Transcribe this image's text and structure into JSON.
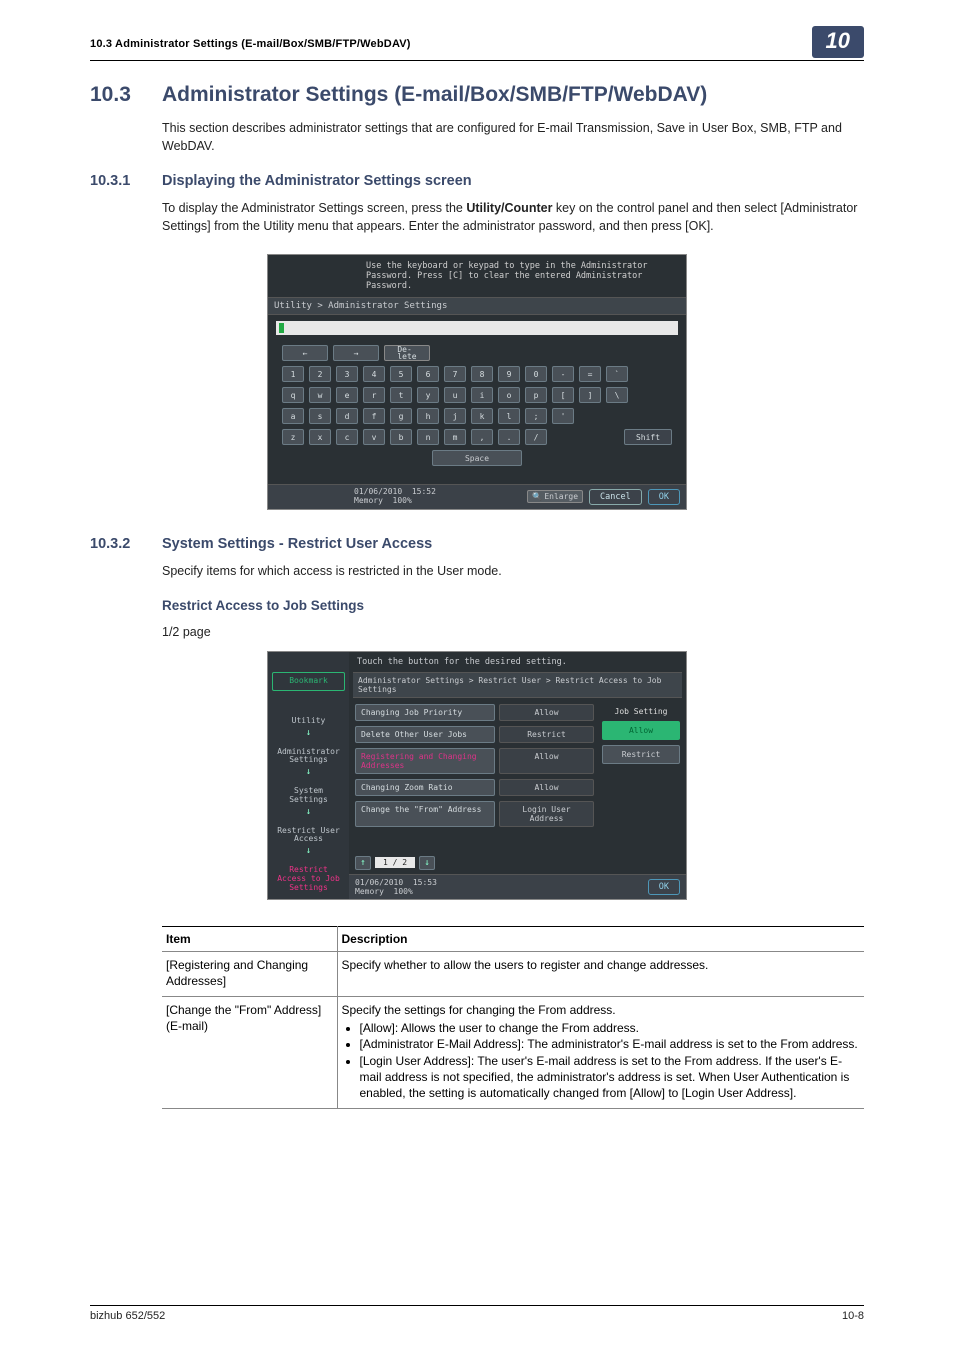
{
  "header": {
    "running_head": "10.3    Administrator Settings (E-mail/Box/SMB/FTP/WebDAV)",
    "chapter_badge": "10"
  },
  "section": {
    "num": "10.3",
    "title": "Administrator Settings (E-mail/Box/SMB/FTP/WebDAV)",
    "intro": "This section describes administrator settings that are configured for E-mail Transmission, Save in User Box, SMB, FTP and WebDAV."
  },
  "sub1": {
    "num": "10.3.1",
    "title": "Displaying the Administrator Settings screen",
    "body_pre": "To display the Administrator Settings screen, press the ",
    "body_bold": "Utility/Counter",
    "body_post": " key on the control panel and then select [Administrator Settings] from the Utility menu that appears. Enter the administrator password, and then press [OK]."
  },
  "keypad": {
    "message": "Use the keyboard or keypad to type in the Administrator Password.  Press [C] to clear the entered Administrator Password.",
    "breadcrumb": "Utility > Administrator Settings",
    "nav_left": "←",
    "nav_right": "→",
    "delete_label": "De-\nlete",
    "rows": [
      [
        "1",
        "2",
        "3",
        "4",
        "5",
        "6",
        "7",
        "8",
        "9",
        "0",
        "-",
        "=",
        "`"
      ],
      [
        "q",
        "w",
        "e",
        "r",
        "t",
        "y",
        "u",
        "i",
        "o",
        "p",
        "[",
        "]",
        "\\"
      ],
      [
        "a",
        "s",
        "d",
        "f",
        "g",
        "h",
        "j",
        "k",
        "l",
        ";",
        "'"
      ],
      [
        "z",
        "x",
        "c",
        "v",
        "b",
        "n",
        "m",
        ",",
        ".",
        "/"
      ]
    ],
    "shift_label": "Shift",
    "space_label": "Space",
    "timestamp_date": "01/06/2010",
    "timestamp_time": "15:52",
    "memory_label": "Memory",
    "memory_value": "100%",
    "lang_label": "Enlarge",
    "cancel_label": "Cancel",
    "ok_label": "OK"
  },
  "sub2": {
    "num": "10.3.2",
    "title": "System Settings - Restrict User Access",
    "body": "Specify items for which access is restricted in the User mode."
  },
  "sub2_h3": "Restrict Access to Job Settings",
  "sub2_page_label": "1/2 page",
  "restrict": {
    "message": "Touch the button for the desired setting.",
    "breadcrumb": "Administrator Settings > Restrict User > Restrict Access to Job Settings",
    "side": {
      "bookmark": "Bookmark",
      "items": [
        "Utility",
        "Administrator Settings",
        "System Settings",
        "Restrict User Access",
        "Restrict Access to Job Settings"
      ]
    },
    "options": [
      {
        "label": "Changing Job Priority",
        "value": "Allow"
      },
      {
        "label": "Delete Other User Jobs",
        "value": "Restrict"
      },
      {
        "label": "Registering and Changing Addresses",
        "value": "Allow"
      },
      {
        "label": "Changing Zoom Ratio",
        "value": "Allow"
      },
      {
        "label": "Change the \"From\" Address",
        "value": "Login User Address"
      }
    ],
    "right_title": "Job Setting",
    "right_allow": "Allow",
    "right_restrict": "Restrict",
    "pager": "1 / 2",
    "timestamp_date": "01/06/2010",
    "timestamp_time": "15:53",
    "memory_label": "Memory",
    "memory_value": "100%",
    "ok_label": "OK"
  },
  "table": {
    "h_item": "Item",
    "h_desc": "Description",
    "rows": [
      {
        "item": "[Registering and Changing Addresses]",
        "desc_plain": "Specify whether to allow the users to register and change addresses."
      },
      {
        "item": "[Change the \"From\" Address] (E-mail)",
        "desc_lead": "Specify the settings for changing the From address.",
        "bullets": [
          "[Allow]: Allows the user to change the From address.",
          "[Administrator E-Mail Address]: The administrator's E-mail address is set to the From address.",
          "[Login User Address]: The user's E-mail address is set to the From address. If the user's E-mail address is not specified, the administrator's address is set. When User Authentication is enabled, the setting is automatically changed from [Allow] to [Login User Address]."
        ]
      }
    ]
  },
  "footer": {
    "left": "bizhub 652/552",
    "right": "10-8"
  }
}
